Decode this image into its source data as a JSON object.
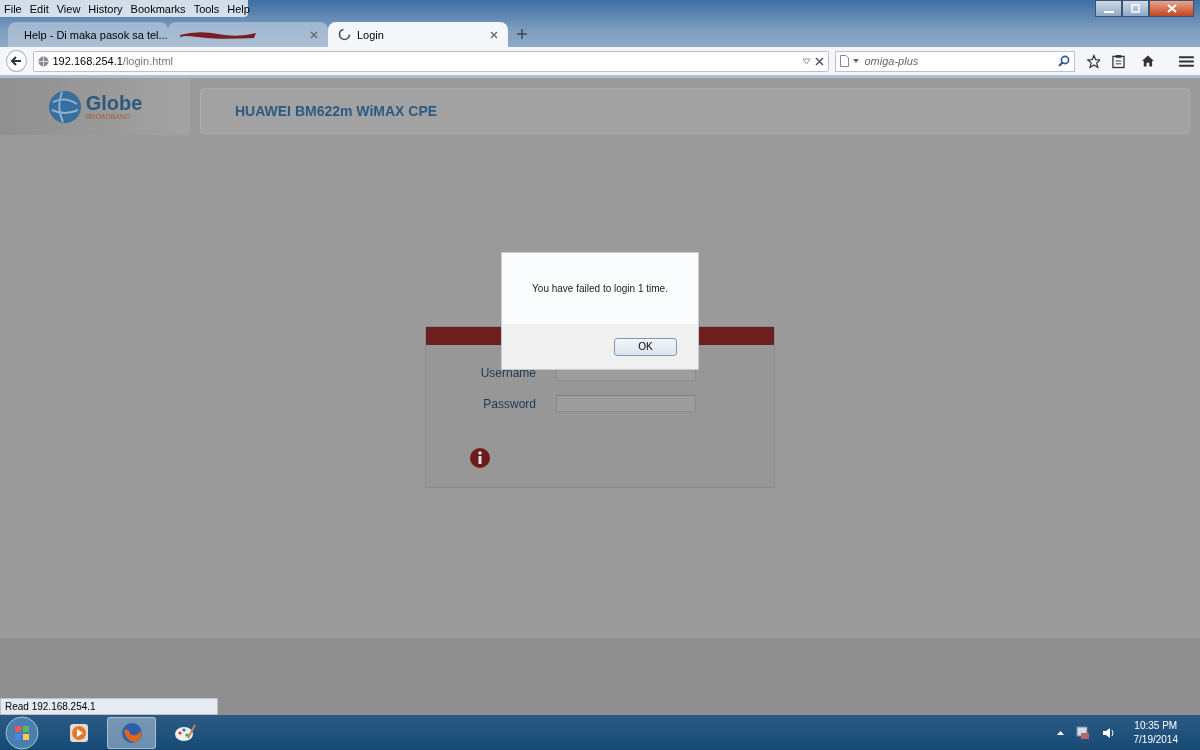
{
  "menu": [
    "File",
    "Edit",
    "View",
    "History",
    "Bookmarks",
    "Tools",
    "Help"
  ],
  "tabs": [
    {
      "title": "Help - Di maka pasok sa tel...",
      "redacted": false,
      "selected": false
    },
    {
      "redacted": true,
      "selected": false
    },
    {
      "title": "Login",
      "redacted": false,
      "selected": true
    }
  ],
  "address": {
    "host": "192.168.254.1",
    "path": "/login.html"
  },
  "search": {
    "placeholder": "omiga-plus"
  },
  "page": {
    "logo": {
      "brand": "Globe",
      "tagline": "BROADBAND"
    },
    "header_title": "HUAWEI BM622m WiMAX CPE",
    "login": {
      "fields": [
        {
          "label": "Username"
        },
        {
          "label": "Password"
        }
      ]
    }
  },
  "dialog": {
    "message": "You have failed to login 1 time.",
    "button": "OK"
  },
  "status_text": "Read 192.168.254.1",
  "taskbar": {
    "apps": [
      {
        "kind": "media",
        "selected": false
      },
      {
        "kind": "browser",
        "selected": true
      },
      {
        "kind": "paint",
        "selected": false
      }
    ],
    "time": "10:35 PM",
    "date": "7/19/2014"
  }
}
